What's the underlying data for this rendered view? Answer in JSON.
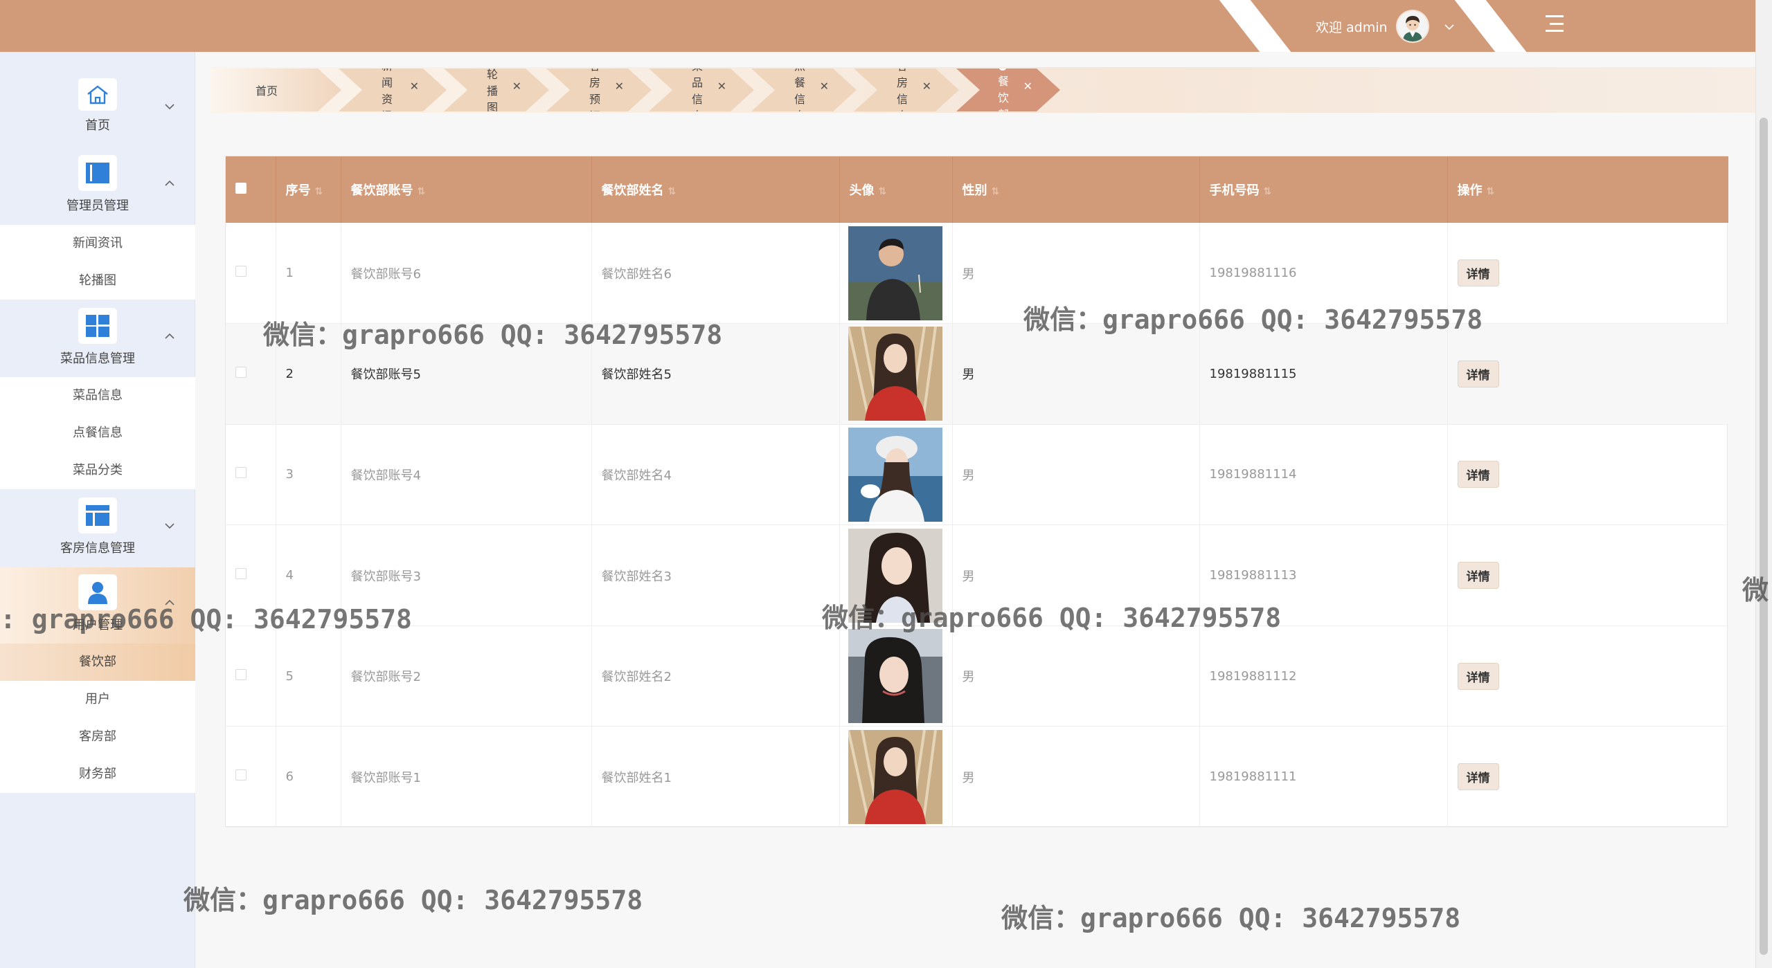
{
  "header": {
    "welcome_text": "欢迎 admin",
    "avatar_icon": "user-avatar-icon",
    "menu_icon": "menu-toggle-icon"
  },
  "sidebar": {
    "groups": [
      {
        "label": "首页",
        "icon": "home-icon",
        "arrow": "chevron-down"
      },
      {
        "label": "管理员管理",
        "icon": "admin-panel-icon",
        "arrow": "chevron-up",
        "children": [
          "新闻资讯",
          "轮播图"
        ]
      },
      {
        "label": "菜品信息管理",
        "icon": "dashboard-grid-icon",
        "arrow": "chevron-up",
        "children": [
          "菜品信息",
          "点餐信息",
          "菜品分类"
        ]
      },
      {
        "label": "客房信息管理",
        "icon": "layout-icon",
        "arrow": "chevron-down"
      },
      {
        "label": "用户管理",
        "icon": "user-icon",
        "arrow": "chevron-up",
        "children": [
          "餐饮部",
          "用户",
          "客房部",
          "财务部"
        ]
      }
    ]
  },
  "tabs": [
    {
      "label": "首页",
      "closable": false
    },
    {
      "label": "新闻资讯",
      "closable": true
    },
    {
      "label": "轮播图",
      "closable": true
    },
    {
      "label": "客房预订",
      "closable": true
    },
    {
      "label": "菜品信息",
      "closable": true
    },
    {
      "label": "点餐信息",
      "closable": true
    },
    {
      "label": "客房信息",
      "closable": true
    },
    {
      "label": "●餐饮部",
      "closable": true,
      "active": true
    }
  ],
  "table": {
    "columns": [
      "序号",
      "餐饮部账号",
      "餐饮部姓名",
      "头像",
      "性别",
      "手机号码",
      "操作"
    ],
    "action_label": "详情",
    "rows": [
      {
        "index": "1",
        "account": "餐饮部账号6",
        "name": "餐饮部姓名6",
        "gender": "男",
        "phone": "19819881116"
      },
      {
        "index": "2",
        "account": "餐饮部账号5",
        "name": "餐饮部姓名5",
        "gender": "男",
        "phone": "19819881115"
      },
      {
        "index": "3",
        "account": "餐饮部账号4",
        "name": "餐饮部姓名4",
        "gender": "男",
        "phone": "19819881114"
      },
      {
        "index": "4",
        "account": "餐饮部账号3",
        "name": "餐饮部姓名3",
        "gender": "男",
        "phone": "19819881113"
      },
      {
        "index": "5",
        "account": "餐饮部账号2",
        "name": "餐饮部姓名2",
        "gender": "男",
        "phone": "19819881112"
      },
      {
        "index": "6",
        "account": "餐饮部账号1",
        "name": "餐饮部姓名1",
        "gender": "男",
        "phone": "19819881111"
      }
    ]
  },
  "watermark": {
    "text": "微信：grapro666 QQ: 3642795578",
    "fragment_left": ": grapro666 QQ: 3642795578",
    "fragment_right": "微"
  },
  "colors": {
    "accent": "#d19a78",
    "accent_dark": "#d4957b",
    "sidebar_bg": "#eaeef8",
    "icon_blue": "#2f80d8"
  }
}
